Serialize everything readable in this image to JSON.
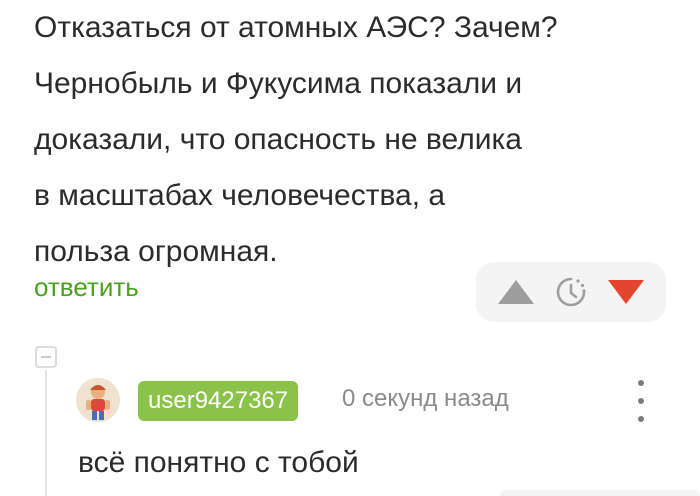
{
  "comment": {
    "lines": [
      "Отказаться от атомных АЭС? Зачем?",
      "Чернобыль и Фукусима показали и",
      "доказали, что опасность не велика",
      "в масштабах человечества, а",
      "польза огромная."
    ],
    "reply_label": "ответить"
  },
  "votes": {
    "up_icon": "upvote-triangle",
    "save_icon": "clock-icon",
    "down_icon": "downvote-triangle",
    "colors": {
      "up": "#9e9e9e",
      "down": "#e4452f",
      "bar_bg": "#f4f4f4"
    }
  },
  "reply": {
    "username": "user9427367",
    "timestamp": "0 секунд назад",
    "text": "всё понятно с тобой",
    "colors": {
      "username_bg": "#8bc34a",
      "link": "#4aa11e"
    }
  }
}
